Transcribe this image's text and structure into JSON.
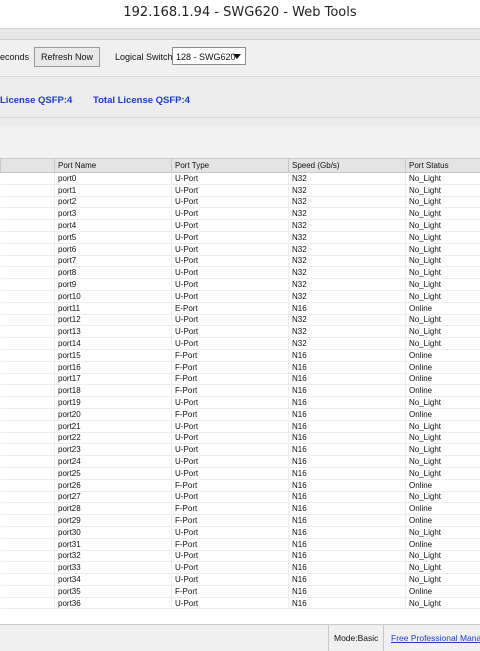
{
  "window": {
    "title": "192.168.1.94 - SWG620 - Web Tools"
  },
  "toolbar": {
    "seconds_label": "econds",
    "refresh_label": "Refresh Now",
    "logical_switch_label": "Logical Switch",
    "logical_switch_value": "128 - SWG620"
  },
  "license": {
    "license_qsfp": "License QSFP:4",
    "total_license_qsfp": "Total License QSFP:4"
  },
  "table": {
    "headers": [
      "",
      "Port Name",
      "Port Type",
      "Speed (Gb/s)",
      "Port Status"
    ],
    "rows": [
      [
        "port0",
        "U-Port",
        "N32",
        "No_Light"
      ],
      [
        "port1",
        "U-Port",
        "N32",
        "No_Light"
      ],
      [
        "port2",
        "U-Port",
        "N32",
        "No_Light"
      ],
      [
        "port3",
        "U-Port",
        "N32",
        "No_Light"
      ],
      [
        "port4",
        "U-Port",
        "N32",
        "No_Light"
      ],
      [
        "port5",
        "U-Port",
        "N32",
        "No_Light"
      ],
      [
        "port6",
        "U-Port",
        "N32",
        "No_Light"
      ],
      [
        "port7",
        "U-Port",
        "N32",
        "No_Light"
      ],
      [
        "port8",
        "U-Port",
        "N32",
        "No_Light"
      ],
      [
        "port9",
        "U-Port",
        "N32",
        "No_Light"
      ],
      [
        "port10",
        "U-Port",
        "N32",
        "No_Light"
      ],
      [
        "port11",
        "E-Port",
        "N16",
        "Online"
      ],
      [
        "port12",
        "U-Port",
        "N32",
        "No_Light"
      ],
      [
        "port13",
        "U-Port",
        "N32",
        "No_Light"
      ],
      [
        "port14",
        "U-Port",
        "N32",
        "No_Light"
      ],
      [
        "port15",
        "F-Port",
        "N16",
        "Online"
      ],
      [
        "port16",
        "F-Port",
        "N16",
        "Online"
      ],
      [
        "port17",
        "F-Port",
        "N16",
        "Online"
      ],
      [
        "port18",
        "F-Port",
        "N16",
        "Online"
      ],
      [
        "port19",
        "U-Port",
        "N16",
        "No_Light"
      ],
      [
        "port20",
        "F-Port",
        "N16",
        "Online"
      ],
      [
        "port21",
        "U-Port",
        "N16",
        "No_Light"
      ],
      [
        "port22",
        "U-Port",
        "N16",
        "No_Light"
      ],
      [
        "port23",
        "U-Port",
        "N16",
        "No_Light"
      ],
      [
        "port24",
        "U-Port",
        "N16",
        "No_Light"
      ],
      [
        "port25",
        "U-Port",
        "N16",
        "No_Light"
      ],
      [
        "port26",
        "F-Port",
        "N16",
        "Online"
      ],
      [
        "port27",
        "U-Port",
        "N16",
        "No_Light"
      ],
      [
        "port28",
        "F-Port",
        "N16",
        "Online"
      ],
      [
        "port29",
        "F-Port",
        "N16",
        "Online"
      ],
      [
        "port30",
        "U-Port",
        "N16",
        "No_Light"
      ],
      [
        "port31",
        "F-Port",
        "N16",
        "Online"
      ],
      [
        "port32",
        "U-Port",
        "N16",
        "No_Light"
      ],
      [
        "port33",
        "U-Port",
        "N16",
        "No_Light"
      ],
      [
        "port34",
        "U-Port",
        "N16",
        "No_Light"
      ],
      [
        "port35",
        "F-Port",
        "N16",
        "Online"
      ],
      [
        "port36",
        "U-Port",
        "N16",
        "No_Light"
      ]
    ]
  },
  "status": {
    "mode": "Mode:Basic",
    "link": "Free Professional Manag"
  }
}
